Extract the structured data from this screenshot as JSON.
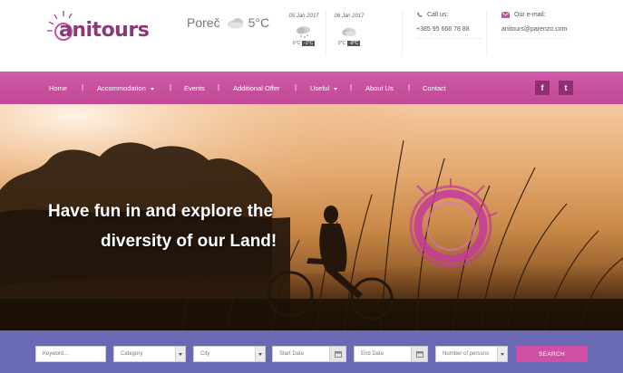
{
  "header": {
    "logo_text": "anitours",
    "weather": {
      "city": "Poreč",
      "temp": "5°C"
    },
    "forecast": [
      {
        "date": "05 Jan 2017",
        "icon": "snow-cloud-icon",
        "high": "6°C",
        "low": "-1°C"
      },
      {
        "date": "06 Jan 2017",
        "icon": "cloud-icon",
        "high": "0°C",
        "low": "-8°C"
      }
    ],
    "call": {
      "label": "Call us:",
      "value": "+385 95 666 78 88"
    },
    "email": {
      "label": "Our e-mail:",
      "value": "anitours@parenzo.com"
    }
  },
  "nav": {
    "items": [
      {
        "label": "Home"
      },
      {
        "label": "Accommodation",
        "dropdown": true
      },
      {
        "label": "Events"
      },
      {
        "label": "Additional Offer"
      },
      {
        "label": "Useful",
        "dropdown": true
      },
      {
        "label": "About Us"
      },
      {
        "label": "Contact"
      }
    ],
    "separator": "|",
    "social": [
      {
        "icon": "facebook-icon",
        "glyph": "f"
      },
      {
        "icon": "twitter-icon",
        "glyph": "t"
      }
    ]
  },
  "hero": {
    "line1": "Have fun in and explore the",
    "line2": "diversity of our Land!"
  },
  "search": {
    "keyword_placeholder": "Keyword...",
    "category": "Category",
    "city": "City",
    "start_date": "Start Date",
    "end_date": "End Date",
    "persons": "Number of persons",
    "button": "SEARCH"
  },
  "colors": {
    "brand": "#8b3a78",
    "nav": "#c94fa0",
    "searchbar": "#6a69b3",
    "button": "#d04fa5"
  }
}
